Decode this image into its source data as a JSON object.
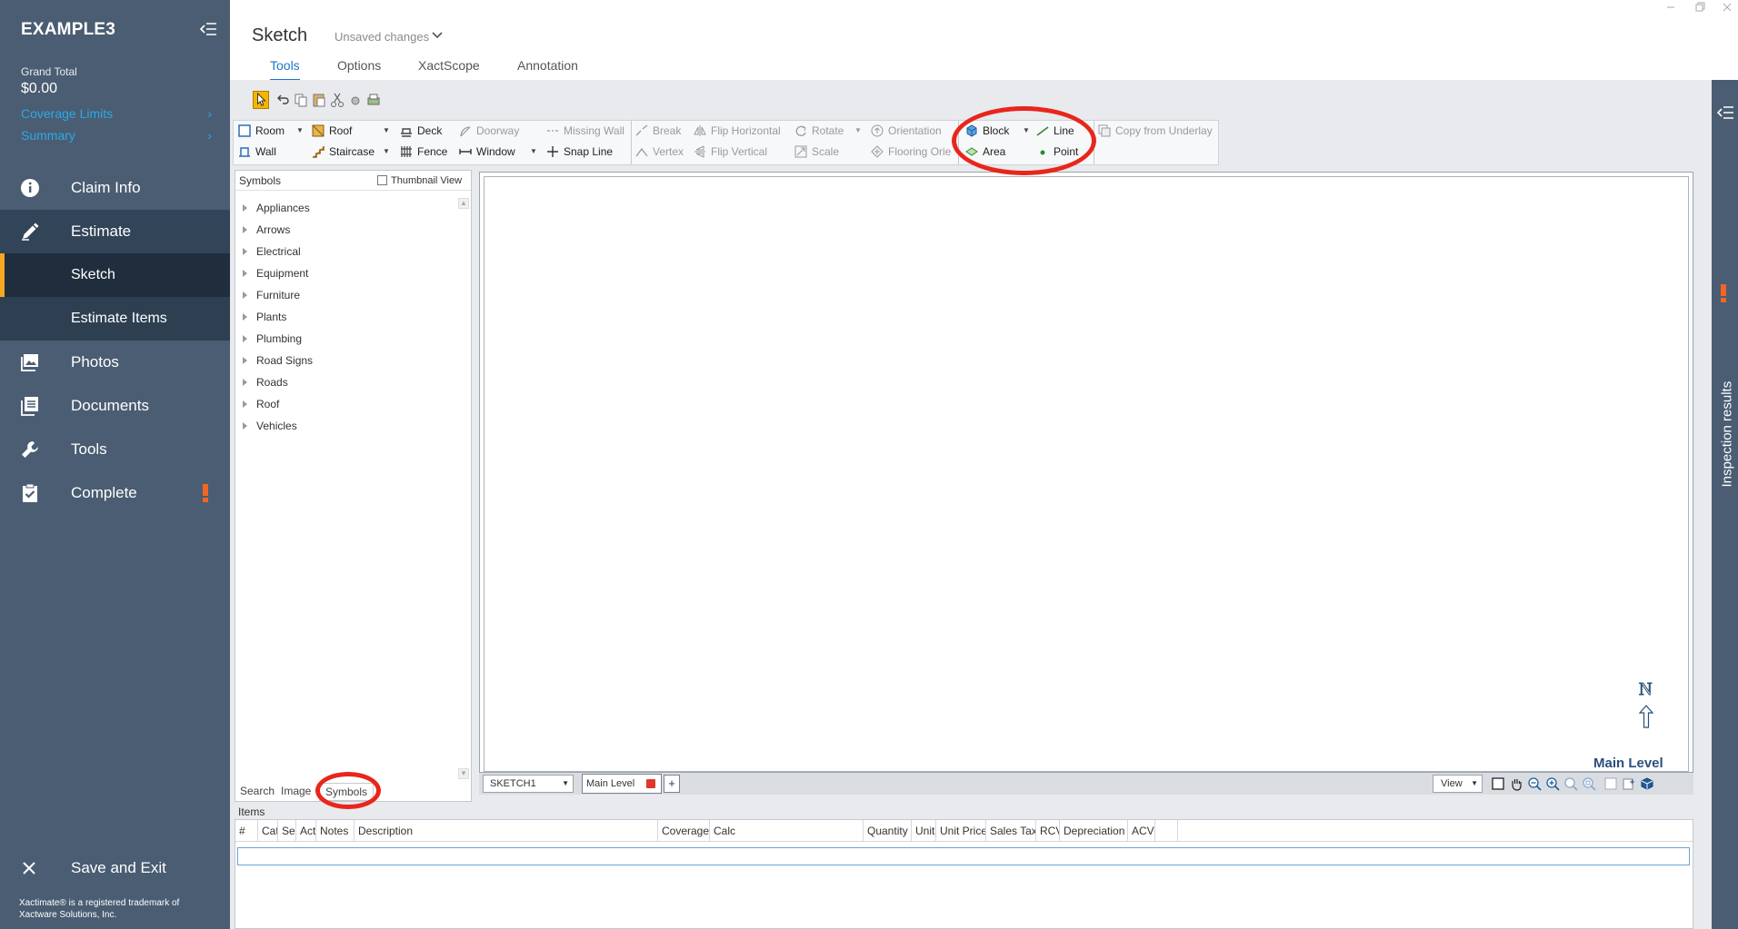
{
  "app": {
    "name": "EXAMPLE3",
    "grand_total_label": "Grand Total",
    "grand_total_value": "$0.00",
    "links": [
      {
        "label": "Coverage Limits"
      },
      {
        "label": "Summary"
      }
    ],
    "accent_color": "#f5a623",
    "link_color": "#2ea8e6"
  },
  "nav": {
    "claim_info": "Claim Info",
    "estimate": "Estimate",
    "sketch": "Sketch",
    "estimate_items": "Estimate Items",
    "photos": "Photos",
    "documents": "Documents",
    "tools": "Tools",
    "complete": "Complete",
    "save_exit": "Save and Exit",
    "trademark": "Xactimate® is a registered trademark of Xactware Solutions, Inc."
  },
  "header": {
    "title": "Sketch",
    "status": "Unsaved changes",
    "tabs": [
      "Tools",
      "Options",
      "XactScope",
      "Annotation"
    ],
    "active_tab": "Tools"
  },
  "ribbon": {
    "room": "Room",
    "wall": "Wall",
    "roof": "Roof",
    "staircase": "Staircase",
    "deck": "Deck",
    "fence": "Fence",
    "doorway": "Doorway",
    "window": "Window",
    "missing_wall": "Missing Wall",
    "snap_line": "Snap Line",
    "break": "Break",
    "vertex": "Vertex",
    "flip_horizontal": "Flip Horizontal",
    "flip_vertical": "Flip Vertical",
    "rotate": "Rotate",
    "scale": "Scale",
    "orientation": "Orientation",
    "flooring_orientation": "Flooring Orie",
    "block": "Block",
    "area": "Area",
    "line": "Line",
    "point": "Point",
    "copy_from_underlay": "Copy from Underlay"
  },
  "symbols": {
    "title": "Symbols",
    "thumbnail_view": "Thumbnail View",
    "categories": [
      "Appliances",
      "Arrows",
      "Electrical",
      "Equipment",
      "Furniture",
      "Plants",
      "Plumbing",
      "Road Signs",
      "Roads",
      "Roof",
      "Vehicles"
    ],
    "bottom_tabs": [
      "Search",
      "Image",
      "Symbols"
    ],
    "active_bottom_tab": "Symbols"
  },
  "canvas": {
    "sketch_name": "SKETCH1",
    "level_tab": "Main Level",
    "add_tab": "+",
    "view_label": "View",
    "level_label": "Main Level",
    "north_label": "N"
  },
  "items": {
    "label": "Items",
    "columns": [
      "#",
      "Cat",
      "Sel",
      "Act",
      "Notes",
      "Description",
      "Coverage",
      "Calc",
      "Quantity",
      "Unit",
      "Unit Price",
      "Sales Tax",
      "RCV",
      "Depreciation",
      "ACV"
    ]
  },
  "right_panel": {
    "label": "Inspection results"
  },
  "icons": {
    "claim_info": "info-circle-icon",
    "estimate": "pencil-icon",
    "photos": "photos-icon",
    "documents": "documents-icon",
    "tools": "wrench-icon",
    "complete": "clipboard-check-icon",
    "save_exit": "close-icon"
  },
  "colors": {
    "sidebar": "#4a5d72",
    "highlight": "#e8261c",
    "warning": "#f26522",
    "tab_active": "#1a77c9"
  }
}
